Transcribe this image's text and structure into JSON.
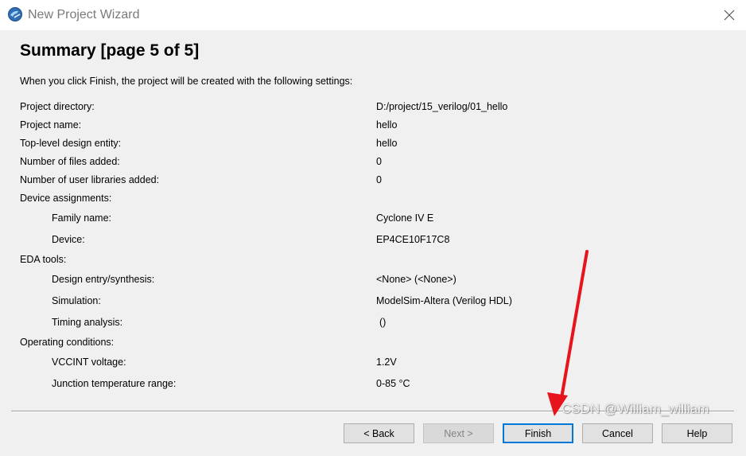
{
  "window": {
    "title": "New Project Wizard",
    "close_icon": "close-icon",
    "app_icon": "quartus-app-icon"
  },
  "page": {
    "heading": "Summary [page 5 of 5]",
    "intro": "When you click Finish, the project will be created with the following settings:"
  },
  "settings": {
    "project_directory": {
      "label": "Project directory:",
      "value": "D:/project/15_verilog/01_hello"
    },
    "project_name": {
      "label": "Project name:",
      "value": "hello"
    },
    "top_level_entity": {
      "label": "Top-level design entity:",
      "value": "hello"
    },
    "files_added": {
      "label": "Number of files added:",
      "value": "0"
    },
    "user_libraries_added": {
      "label": "Number of user libraries added:",
      "value": "0"
    },
    "device_assignments": {
      "label": "Device assignments:"
    },
    "family_name": {
      "label": "Family name:",
      "value": "Cyclone IV E"
    },
    "device": {
      "label": "Device:",
      "value": "EP4CE10F17C8"
    },
    "eda_tools": {
      "label": "EDA tools:"
    },
    "design_entry": {
      "label": "Design entry/synthesis:",
      "value": "<None> (<None>)"
    },
    "simulation": {
      "label": "Simulation:",
      "value": "ModelSim-Altera (Verilog HDL)"
    },
    "timing_analysis": {
      "label": "Timing analysis:",
      "value": "()"
    },
    "operating_conditions": {
      "label": "Operating conditions:"
    },
    "vccint_voltage": {
      "label": "VCCINT voltage:",
      "value": "1.2V"
    },
    "junction_temp": {
      "label": "Junction temperature range:",
      "value": "0-85 °C"
    }
  },
  "buttons": {
    "back": "< Back",
    "next": "Next >",
    "finish": "Finish",
    "cancel": "Cancel",
    "help": "Help"
  },
  "watermark": "CSDN @William_william",
  "colors": {
    "accent": "#0078d7",
    "annotation_arrow": "#e8141c",
    "title_text": "#7a7a7a"
  }
}
